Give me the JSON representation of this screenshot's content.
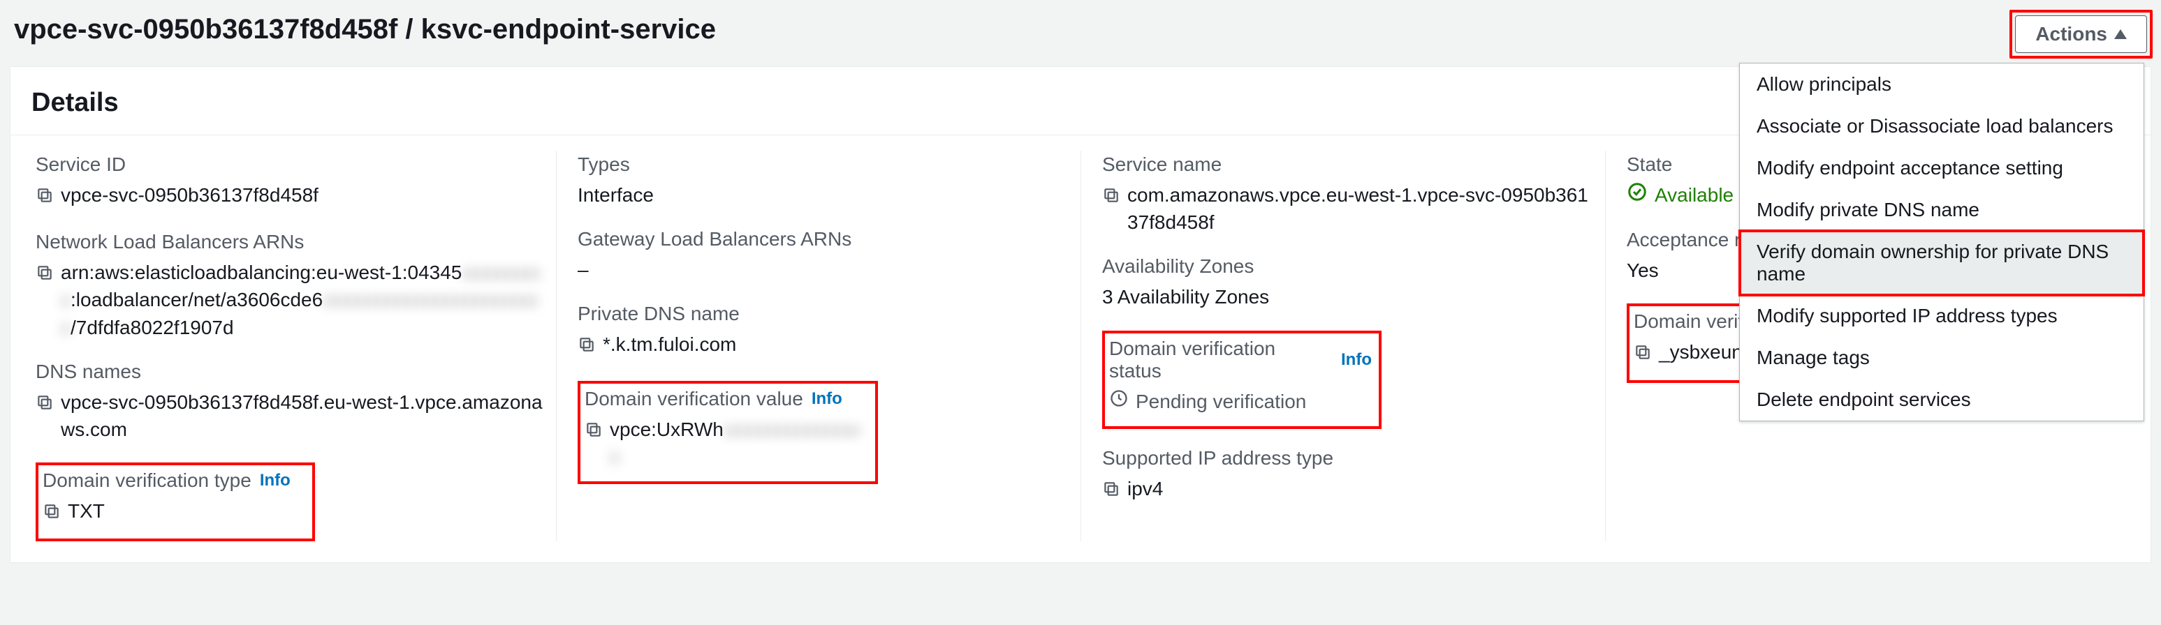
{
  "header": {
    "title": "vpce-svc-0950b36137f8d458f / ksvc-endpoint-service",
    "actions_label": "Actions"
  },
  "actions_menu": [
    "Allow principals",
    "Associate or Disassociate load balancers",
    "Modify endpoint acceptance setting",
    "Modify private DNS name",
    "Verify domain ownership for private DNS name",
    "Modify supported IP address types",
    "Manage tags",
    "Delete endpoint services"
  ],
  "details": {
    "section_title": "Details",
    "info_label": "Info",
    "col1": {
      "service_id_label": "Service ID",
      "service_id_value": "vpce-svc-0950b36137f8d458f",
      "nlb_label": "Network Load Balancers ARNs",
      "nlb_value_a": "arn:aws:elasticloadbalancing:eu-west-1:04345",
      "nlb_value_b": ":loadbalancer/net/a3606cde6",
      "nlb_value_c": "/7dfdfa8022f1907d",
      "dns_label": "DNS names",
      "dns_value": "vpce-svc-0950b36137f8d458f.eu-west-1.vpce.amazonaws.com",
      "dvt_label": "Domain verification type",
      "dvt_value": "TXT"
    },
    "col2": {
      "types_label": "Types",
      "types_value": "Interface",
      "glb_label": "Gateway Load Balancers ARNs",
      "glb_value": "–",
      "pdns_label": "Private DNS name",
      "pdns_value": "*.k.tm.fuloi.com",
      "dvv_label": "Domain verification value",
      "dvv_value": "vpce:UxRWh"
    },
    "col3": {
      "sname_label": "Service name",
      "sname_value": "com.amazonaws.vpce.eu-west-1.vpce-svc-0950b36137f8d458f",
      "az_label": "Availability Zones",
      "az_value": "3 Availability Zones",
      "dvs_label": "Domain verification status",
      "dvs_value": "Pending verification",
      "sip_label": "Supported IP address type",
      "sip_value": "ipv4"
    },
    "col4": {
      "state_label": "State",
      "state_value": "Available",
      "accept_label": "Acceptance required",
      "accept_value": "Yes",
      "dvn_label": "Domain verification name",
      "dvn_value": "_ysbxeunqja"
    }
  }
}
